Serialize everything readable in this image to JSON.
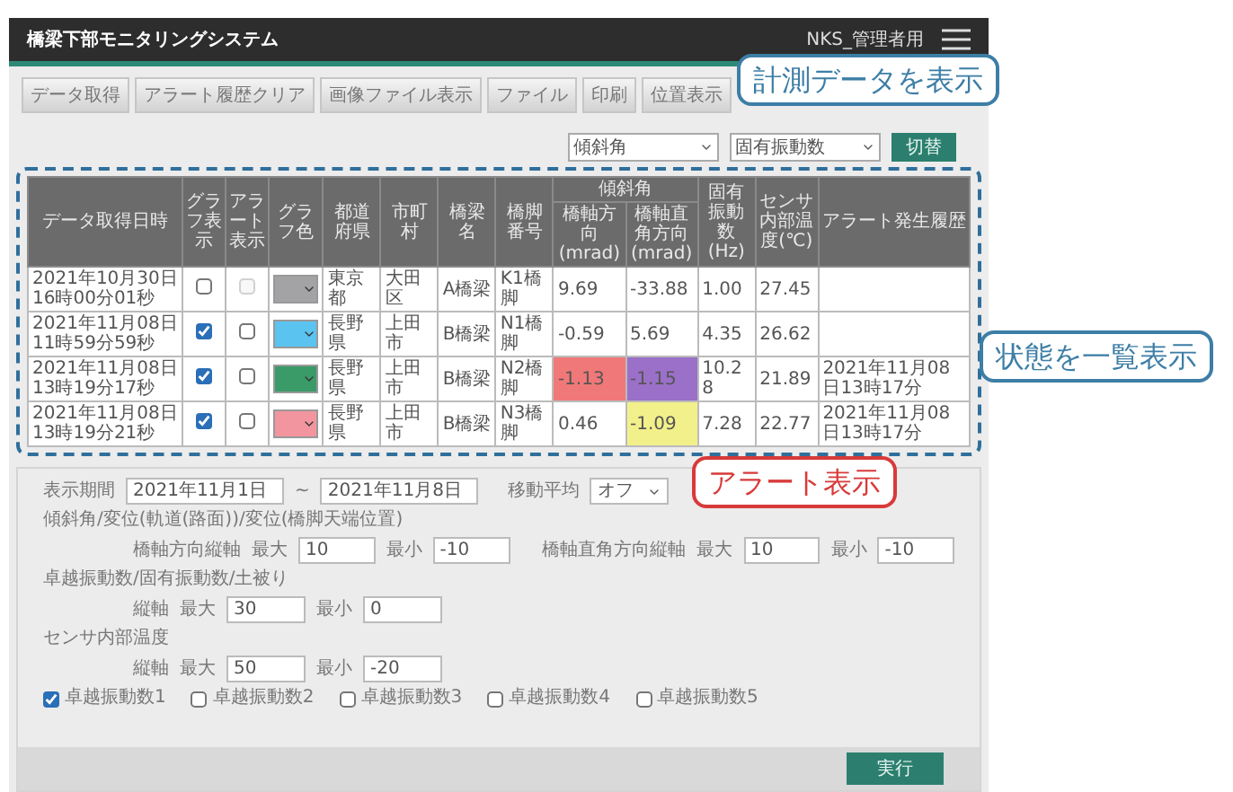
{
  "app": {
    "title": "橋梁下部モニタリングシステム",
    "user": "NKS_管理者用"
  },
  "toolbar": [
    "データ取得",
    "アラート履歴クリア",
    "画像ファイル表示",
    "ファイル",
    "印刷",
    "位置表示"
  ],
  "view_selects": [
    "傾斜角",
    "固有振動数"
  ],
  "switch_button": "切替",
  "table": {
    "columns": [
      {
        "label": "データ取得日時"
      },
      {
        "label": "グラフ表示"
      },
      {
        "label": "アラート表示"
      },
      {
        "label": "グラフ色"
      },
      {
        "label": "都道府県"
      },
      {
        "label": "市町村"
      },
      {
        "label": "橋梁名"
      },
      {
        "label": "橋脚番号"
      },
      {
        "label": "傾斜角",
        "children": [
          {
            "label": "橋軸方向",
            "unit": "(mrad)"
          },
          {
            "label": "橋軸直角方向",
            "unit": "(mrad)"
          }
        ]
      },
      {
        "label": "固有振動数",
        "unit": "(Hz)"
      },
      {
        "label": "センサ内部温度(℃)"
      },
      {
        "label": "アラート発生履歴"
      }
    ],
    "rows": [
      {
        "datetime": "2021年10月30日16時00分01秒",
        "graph_checked": false,
        "alert_checked": false,
        "alert_disabled": true,
        "color": "#a3a3a6",
        "prefecture": "東京都",
        "city": "大田区",
        "bridge": "A橋梁",
        "pier": "K1橋脚",
        "values": [
          {
            "text": "9.69"
          },
          {
            "text": "-33.88"
          },
          {
            "text": "1.00"
          },
          {
            "text": "27.45"
          }
        ]
      },
      {
        "datetime": "2021年11月08日11時59分59秒",
        "graph_checked": true,
        "alert_checked": false,
        "alert_disabled": false,
        "color": "#5bc3f0",
        "prefecture": "長野県",
        "city": "上田市",
        "bridge": "B橋梁",
        "pier": "N1橋脚",
        "values": [
          {
            "text": "-0.59"
          },
          {
            "text": "5.69"
          },
          {
            "text": "4.35"
          },
          {
            "text": "26.62"
          }
        ]
      },
      {
        "datetime": "2021年11月08日13時19分17秒",
        "graph_checked": true,
        "alert_checked": false,
        "alert_disabled": false,
        "color": "#3a9a68",
        "prefecture": "長野県",
        "city": "上田市",
        "bridge": "B橋梁",
        "pier": "N2橋脚",
        "values": [
          {
            "text": "-1.13",
            "color": "#f07878"
          },
          {
            "text": "-1.15",
            "color": "#9a70c8"
          },
          {
            "text": "10.28"
          },
          {
            "text": "21.89"
          }
        ],
        "history": "2021年11月08日13時17分"
      },
      {
        "datetime": "2021年11月08日13時19分21秒",
        "graph_checked": true,
        "alert_checked": false,
        "alert_disabled": false,
        "color": "#f2959e",
        "prefecture": "長野県",
        "city": "上田市",
        "bridge": "B橋梁",
        "pier": "N3橋脚",
        "values": [
          {
            "text": "0.46"
          },
          {
            "text": "-1.09",
            "color": "#f2f08a"
          },
          {
            "text": "7.28"
          },
          {
            "text": "22.77"
          }
        ],
        "history": "2021年11月08日13時17分"
      }
    ]
  },
  "form": {
    "period": {
      "label": "表示期間",
      "from": "2021年11月1日",
      "separator": "~",
      "to": "2021年11月8日"
    },
    "moving_average": {
      "label": "移動平均",
      "value": "オフ"
    },
    "groups": [
      {
        "title": "傾斜角/変位(軌道(路面))/変位(橋脚天端位置)",
        "axes": [
          {
            "label": "橋軸方向縦軸",
            "max_label": "最大",
            "max": "10",
            "min_label": "最小",
            "min": "-10"
          },
          {
            "label": "橋軸直角方向縦軸",
            "max_label": "最大",
            "max": "10",
            "min_label": "最小",
            "min": "-10"
          }
        ]
      },
      {
        "title": "卓越振動数/固有振動数/土被り",
        "axes": [
          {
            "label": "縦軸",
            "max_label": "最大",
            "max": "30",
            "min_label": "最小",
            "min": "0"
          }
        ]
      },
      {
        "title": "センサ内部温度",
        "axes": [
          {
            "label": "縦軸",
            "max_label": "最大",
            "max": "50",
            "min_label": "最小",
            "min": "-20"
          }
        ]
      }
    ],
    "checkboxes": [
      {
        "label": "卓越振動数1",
        "checked": true
      },
      {
        "label": "卓越振動数2",
        "checked": false
      },
      {
        "label": "卓越振動数3",
        "checked": false
      },
      {
        "label": "卓越振動数4",
        "checked": false
      },
      {
        "label": "卓越振動数5",
        "checked": false
      }
    ],
    "execute_button": "実行"
  },
  "callouts": [
    {
      "text": "計測データを表示",
      "kind": "info"
    },
    {
      "text": "状態を一覧表示",
      "kind": "info"
    },
    {
      "text": "アラート表示",
      "kind": "alert"
    }
  ]
}
